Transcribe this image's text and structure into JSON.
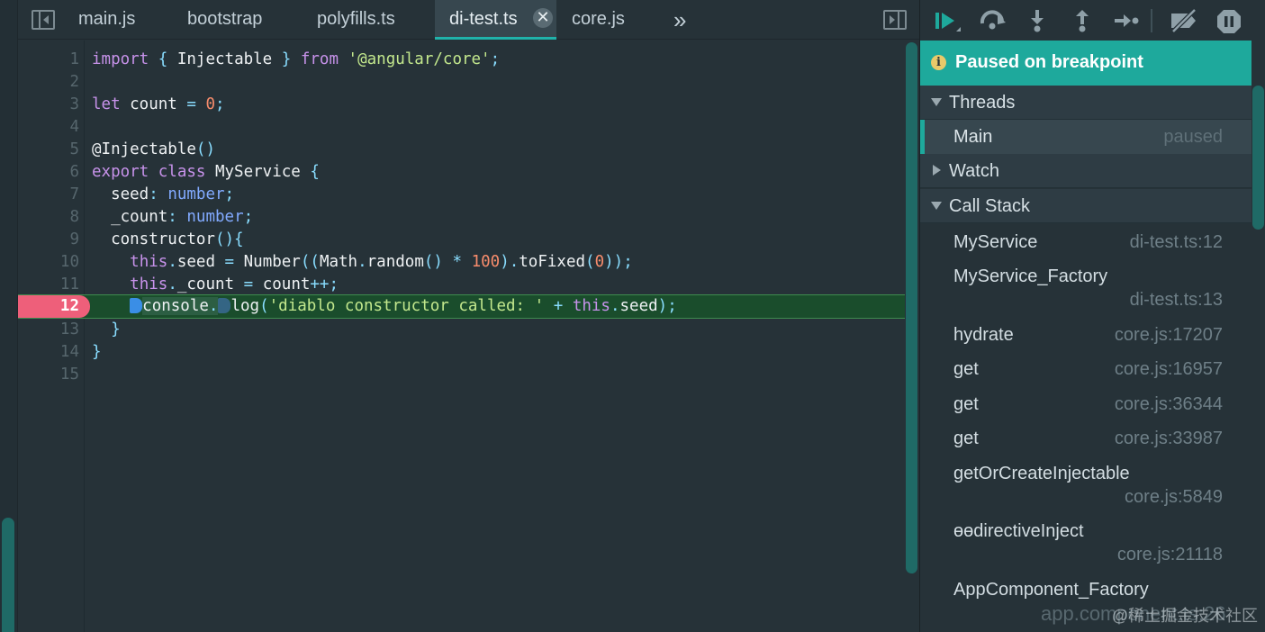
{
  "tabs": [
    {
      "label": "main.js",
      "active": false
    },
    {
      "label": "bootstrap",
      "active": false
    },
    {
      "label": "polyfills.ts",
      "active": false
    },
    {
      "label": "di-test.ts",
      "active": true
    },
    {
      "label": "core.js",
      "active": false
    }
  ],
  "tab_more_label": "»",
  "editor": {
    "current_line": 12,
    "line_numbers": [
      "1",
      "2",
      "3",
      "4",
      "5",
      "6",
      "7",
      "8",
      "9",
      "10",
      "11",
      "12",
      "13",
      "14",
      "15"
    ]
  },
  "debugger": {
    "status": "Paused on breakpoint",
    "status_icon": "info-icon",
    "threads_label": "Threads",
    "thread_main": {
      "name": "Main",
      "state": "paused"
    },
    "watch_label": "Watch",
    "callstack_label": "Call Stack",
    "frames": [
      {
        "fn": "MyService",
        "loc": "di-test.ts:12"
      },
      {
        "fn": "MyService_Factory",
        "loc": "di-test.ts:13"
      },
      {
        "fn": "hydrate",
        "loc": "core.js:17207"
      },
      {
        "fn": "get",
        "loc": "core.js:16957"
      },
      {
        "fn": "get",
        "loc": "core.js:36344"
      },
      {
        "fn": "get",
        "loc": "core.js:33987"
      },
      {
        "fn": "getOrCreateInjectable",
        "loc": "core.js:5849"
      },
      {
        "fn": "ɵɵdirectiveInject",
        "loc": "core.js:21118"
      },
      {
        "fn": "AppComponent_Factory",
        "loc": "app.component.ts:26"
      }
    ],
    "watermark": "@稀土掘金技术社区"
  },
  "colors": {
    "accent": "#1ea99c",
    "breakpoint": "#ee5f7a",
    "current_line": "#1a4d2c"
  }
}
